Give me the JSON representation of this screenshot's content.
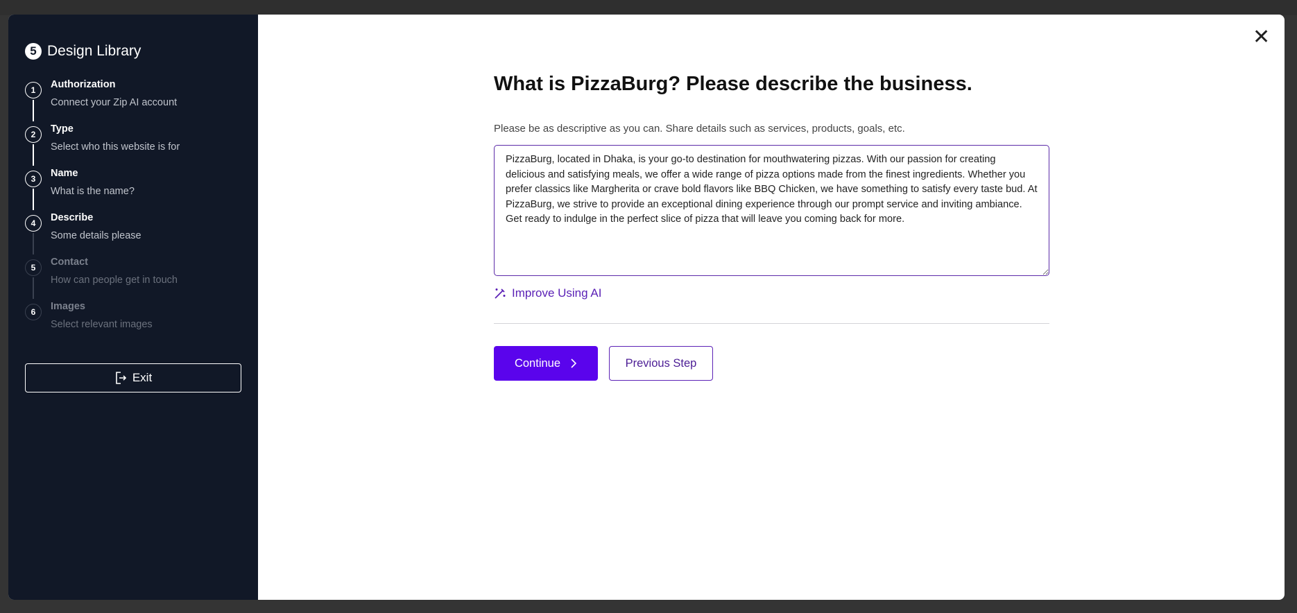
{
  "app": {
    "title": "Design Library",
    "logo_icon": "starter-templates-logo"
  },
  "steps": [
    {
      "num": "1",
      "title": "Authorization",
      "subtitle": "Connect your Zip AI account",
      "state": "done"
    },
    {
      "num": "2",
      "title": "Type",
      "subtitle": "Select who this website is for",
      "state": "done"
    },
    {
      "num": "3",
      "title": "Name",
      "subtitle": "What is the name?",
      "state": "done"
    },
    {
      "num": "4",
      "title": "Describe",
      "subtitle": "Some details please",
      "state": "current"
    },
    {
      "num": "5",
      "title": "Contact",
      "subtitle": "How can people get in touch",
      "state": "upcoming"
    },
    {
      "num": "6",
      "title": "Images",
      "subtitle": "Select relevant images",
      "state": "upcoming"
    }
  ],
  "exit_label": "Exit",
  "main": {
    "heading": "What is PizzaBurg? Please describe the business.",
    "subheading": "Please be as descriptive as you can. Share details such as services, products, goals, etc.",
    "description": "PizzaBurg, located in Dhaka, is your go-to destination for mouthwatering pizzas. With our passion for creating delicious and satisfying meals, we offer a wide range of pizza options made from the finest ingredients. Whether you prefer classics like Margherita or crave bold flavors like BBQ Chicken, we have something to satisfy every taste bud. At PizzaBurg, we strive to provide an exceptional dining experience through our prompt service and inviting ambiance. Get ready to indulge in the perfect slice of pizza that will leave you coming back for more.",
    "improve_label": "Improve Using AI",
    "continue_label": "Continue",
    "previous_label": "Previous Step"
  },
  "colors": {
    "sidebar": "#111827",
    "accent": "#5a04ec",
    "link": "#5b21b6"
  }
}
